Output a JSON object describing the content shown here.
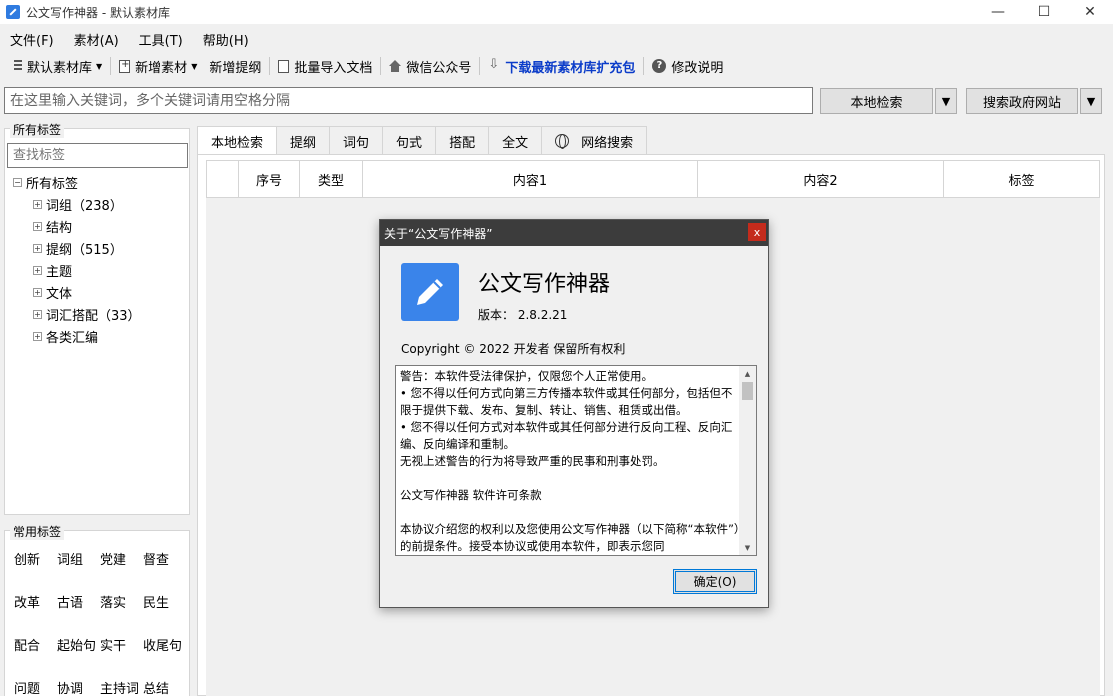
{
  "window": {
    "title": "公文写作神器 - 默认素材库",
    "minimize": "—",
    "maximize": "☐",
    "close": "✕"
  },
  "menu": [
    "文件(F)",
    "素材(A)",
    "工具(T)",
    "帮助(H)"
  ],
  "toolbar": {
    "library": "默认素材库",
    "new_material": "新增素材",
    "new_outline": "新增提纲",
    "import_docs": "批量导入文档",
    "wechat": "微信公众号",
    "download_pack": "下载最新素材库扩充包",
    "help": "修改说明"
  },
  "search": {
    "placeholder": "在这里输入关键词，多个关键词请用空格分隔",
    "local_search": "本地检索",
    "gov_search": "搜索政府网站",
    "drop": "▼"
  },
  "tags_panel": {
    "title": "所有标签",
    "search_placeholder": "查找标签",
    "root": "所有标签",
    "items": [
      "词组（238）",
      "结构",
      "提纲（515）",
      "主题",
      "文体",
      "词汇搭配（33）",
      "各类汇编"
    ]
  },
  "common_tags": {
    "title": "常用标签",
    "items": [
      "创新",
      "词组",
      "党建",
      "督查",
      "改革",
      "古语",
      "落实",
      "民生",
      "配合",
      "起始句",
      "实干",
      "收尾句",
      "问题",
      "协调",
      "主持词",
      "总结"
    ]
  },
  "tabs": [
    "本地检索",
    "提纲",
    "词句",
    "句式",
    "搭配",
    "全文",
    "网络搜索"
  ],
  "table": {
    "columns": [
      "",
      "序号",
      "类型",
      "内容1",
      "内容2",
      "标签"
    ]
  },
  "dialog": {
    "title": "关于“公文写作神器”",
    "close": "x",
    "app_name": "公文写作神器",
    "version": "版本： 2.8.2.21",
    "copyright": "Copyright © 2022  开发者 保留所有权利",
    "license": "警告：本软件受法律保护，仅限您个人正常使用。\n• 您不得以任何方式向第三方传播本软件或其任何部分，包括但不限于提供下载、发布、复制、转让、销售、租赁或出借。\n• 您不得以任何方式对本软件或其任何部分进行反向工程、反向汇编、反向编译和重制。\n无视上述警告的行为将导致严重的民事和刑事处罚。\n\n公文写作神器 软件许可条款\n\n本协议介绍您的权利以及您使用公文写作神器（以下简称“本软件”）的前提条件。接受本协议或使用本软件，即表示您同",
    "ok": "确定(O)"
  }
}
